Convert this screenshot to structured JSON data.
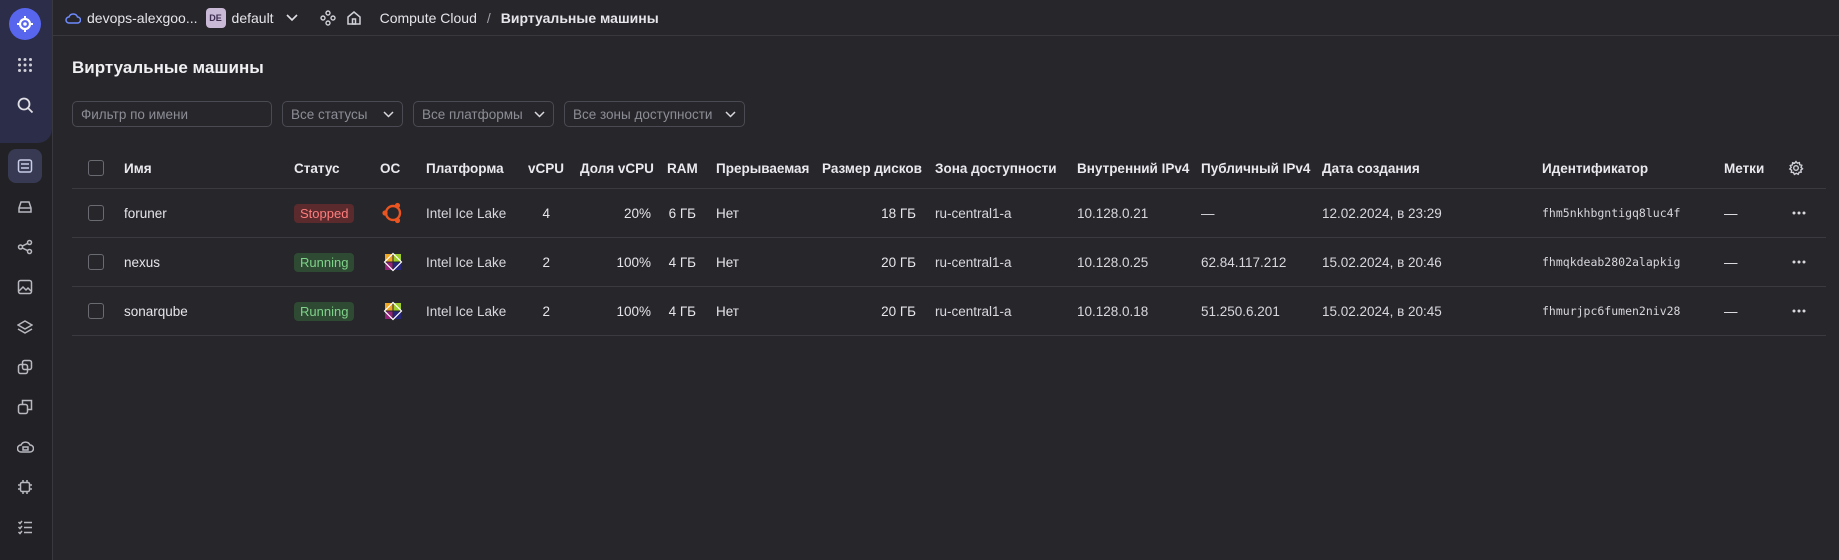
{
  "topbar": {
    "cloud": "devops-alexgoo...",
    "folder_badge": "DE",
    "folder": "default",
    "service": "Compute Cloud",
    "separator": "/",
    "page": "Виртуальные машины"
  },
  "page_title": "Виртуальные машины",
  "filters": {
    "name_placeholder": "Фильтр по имени",
    "status": "Все статусы",
    "platform": "Все платформы",
    "zone": "Все зоны доступности"
  },
  "columns": {
    "name": "Имя",
    "status": "Статус",
    "os": "ОС",
    "platform": "Платформа",
    "vcpu": "vCPU",
    "vcpu_share": "Доля vCPU",
    "ram": "RAM",
    "preemptible": "Прерываемая",
    "disk": "Размер дисков",
    "zone": "Зона доступности",
    "internal_ip": "Внутренний IPv4",
    "public_ip": "Публичный IPv4",
    "created": "Дата создания",
    "id": "Идентификатор",
    "labels": "Метки"
  },
  "rows": [
    {
      "name": "foruner",
      "status": "Stopped",
      "os": "ubuntu-icon",
      "platform": "Intel Ice Lake",
      "vcpu": "4",
      "vcpu_share": "20%",
      "ram": "6 ГБ",
      "preemptible": "Нет",
      "disk": "18 ГБ",
      "zone": "ru-central1-a",
      "internal_ip": "10.128.0.21",
      "public_ip": "—",
      "created": "12.02.2024, в 23:29",
      "id": "fhm5nkhbgntigq8luc4f",
      "labels": "—"
    },
    {
      "name": "nexus",
      "status": "Running",
      "os": "centos-icon",
      "platform": "Intel Ice Lake",
      "vcpu": "2",
      "vcpu_share": "100%",
      "ram": "4 ГБ",
      "preemptible": "Нет",
      "disk": "20 ГБ",
      "zone": "ru-central1-a",
      "internal_ip": "10.128.0.25",
      "public_ip": "62.84.117.212",
      "created": "15.02.2024, в 20:46",
      "id": "fhmqkdeab2802alapkig",
      "labels": "—"
    },
    {
      "name": "sonarqube",
      "status": "Running",
      "os": "centos-icon",
      "platform": "Intel Ice Lake",
      "vcpu": "2",
      "vcpu_share": "100%",
      "ram": "4 ГБ",
      "preemptible": "Нет",
      "disk": "20 ГБ",
      "zone": "ru-central1-a",
      "internal_ip": "10.128.0.18",
      "public_ip": "51.250.6.201",
      "created": "15.02.2024, в 20:45",
      "id": "fhmurjpc6fumen2niv28",
      "labels": "—"
    }
  ],
  "colors": {
    "accent": "#5866ee",
    "stopped_bg": "#5a2a2d",
    "stopped_fg": "#ff7d7d",
    "running_bg": "#2e4a33",
    "running_fg": "#7fd28a"
  }
}
